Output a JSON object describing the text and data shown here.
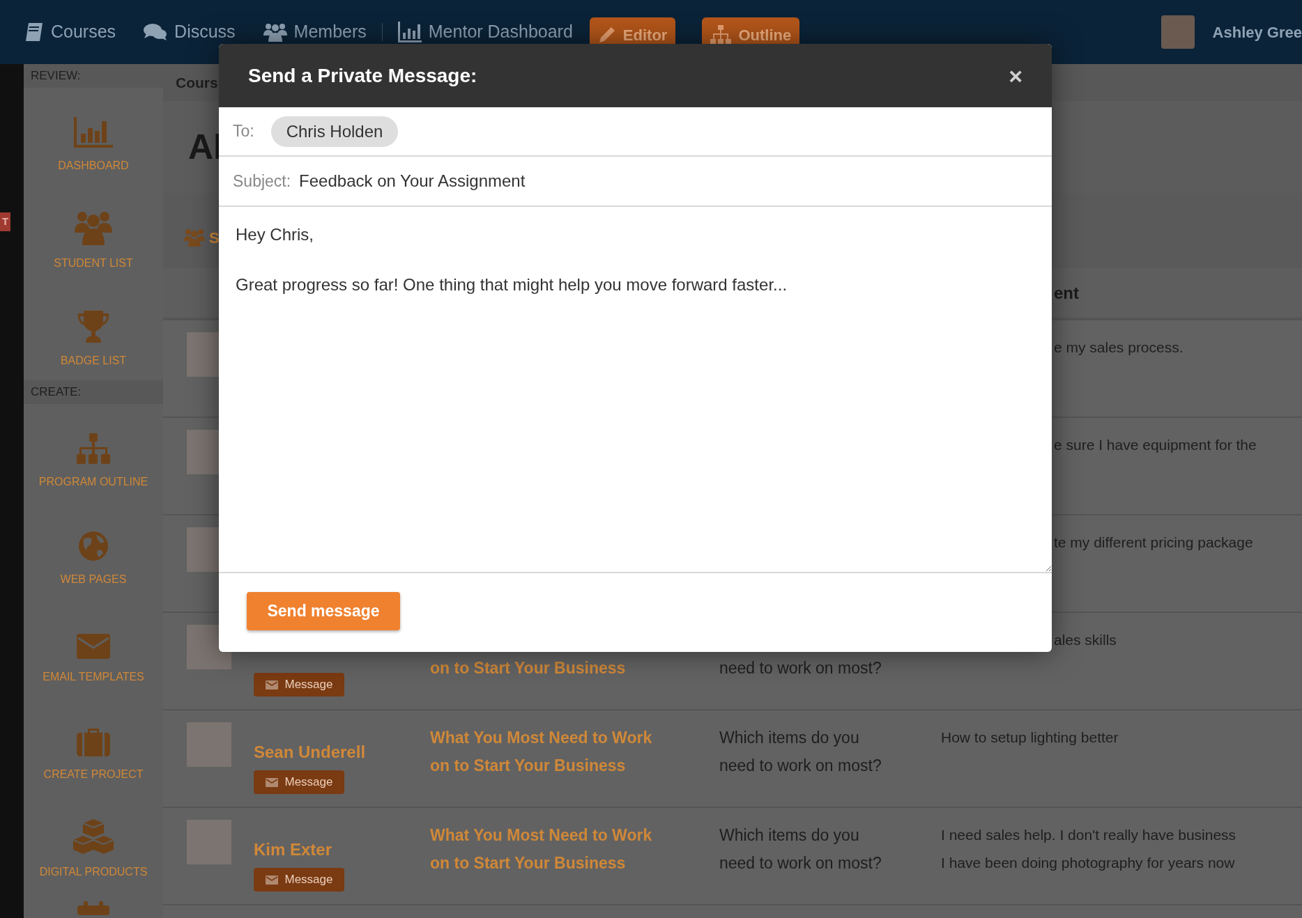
{
  "top_nav": {
    "items": [
      {
        "label": "Courses",
        "kind": "link"
      },
      {
        "label": "Discuss",
        "kind": "link"
      },
      {
        "label": "Members",
        "kind": "link"
      },
      {
        "label": "Mentor Dashboard",
        "kind": "link"
      },
      {
        "label": "Editor",
        "kind": "button"
      },
      {
        "label": "Outline",
        "kind": "button"
      }
    ],
    "user_name": "Ashley Gree"
  },
  "side_tab": "T",
  "sidebar": {
    "sections": [
      {
        "heading": "REVIEW:",
        "items": [
          "DASHBOARD",
          "STUDENT LIST",
          "BADGE LIST"
        ]
      },
      {
        "heading": "CREATE:",
        "items": [
          "PROGRAM OUTLINE",
          "WEB PAGES",
          "EMAIL TEMPLATES",
          "CREATE PROJECT",
          "DIGITAL PRODUCTS"
        ]
      }
    ]
  },
  "breadcrumb": "Cours",
  "page_title": "Al",
  "section_tab": "S",
  "table": {
    "header": "ent",
    "rows": [
      {
        "answer": [
          "e my sales process."
        ]
      },
      {
        "answer": [
          "e sure I have equipment for the"
        ]
      },
      {
        "answer": [
          "te my different pricing package"
        ]
      },
      {
        "button": "Message",
        "course": [
          "on to Start Your Business"
        ],
        "question": [
          "need to work on most?"
        ],
        "answer": [
          "ales skills"
        ]
      },
      {
        "name": "Sean Underell",
        "button": "Message",
        "course": [
          "What You Most Need to Work",
          "on to Start Your Business"
        ],
        "question": [
          "Which items do you",
          "need to work on most?"
        ],
        "answer": [
          "How to setup lighting better"
        ]
      },
      {
        "name": "Kim Exter",
        "button": "Message",
        "course": [
          "What You Most Need to Work",
          "on to Start Your Business"
        ],
        "question": [
          "Which items do you",
          "need to work on most?"
        ],
        "answer": [
          "I need sales help. I don't really have business",
          "I have been doing photography for years now"
        ]
      }
    ]
  },
  "modal": {
    "title": "Send a Private Message:",
    "close": "×",
    "to_label": "To:",
    "recipient": "Chris Holden",
    "subject_label": "Subject:",
    "subject": "Feedback on Your Assignment",
    "body": "Hey Chris,\n\nGreat progress so far! One thing that might help you move forward faster...",
    "send_button": "Send message"
  }
}
